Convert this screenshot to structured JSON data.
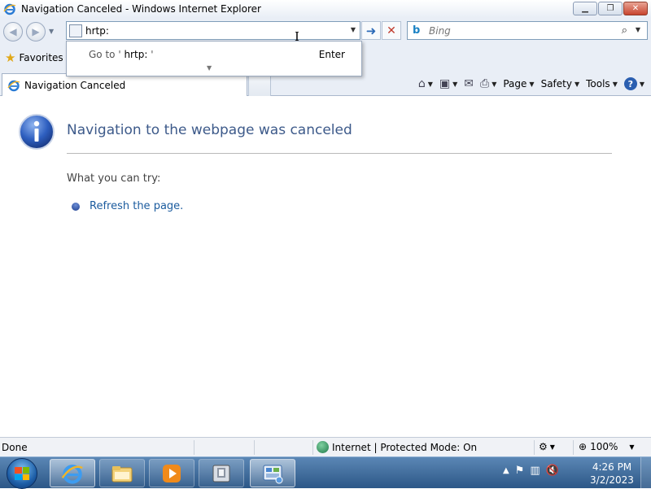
{
  "window": {
    "title": "Navigation Canceled - Windows Internet Explorer"
  },
  "address_bar": {
    "value": "hrtp:"
  },
  "search_bar": {
    "placeholder": "Bing"
  },
  "autocomplete": {
    "goto_prefix": "Go to '",
    "goto_value": "hrtp:",
    "goto_suffix": " '",
    "enter_label": "Enter"
  },
  "favorites": {
    "label": "Favorites"
  },
  "tab": {
    "label": "Navigation Canceled"
  },
  "command_bar": {
    "page_label": "Page",
    "safety_label": "Safety",
    "tools_label": "Tools",
    "help_label": "?"
  },
  "content": {
    "error_title": "Navigation to the webpage was canceled",
    "try_label": "What you can try:",
    "refresh_link": "Refresh the page."
  },
  "status_bar": {
    "status_text": "Done",
    "zone_text": "Internet | Protected Mode: On",
    "zoom_text": "100%"
  },
  "taskbar": {
    "clock_time": "4:26 PM",
    "clock_date": "3/2/2023"
  },
  "icons": {
    "ie": "ie-icon",
    "info": "info-icon",
    "bing": "bing-icon"
  },
  "colors": {
    "title_blue": "#3d5a8a",
    "link_blue": "#1b5b9e",
    "taskbar": "#2c5787"
  }
}
